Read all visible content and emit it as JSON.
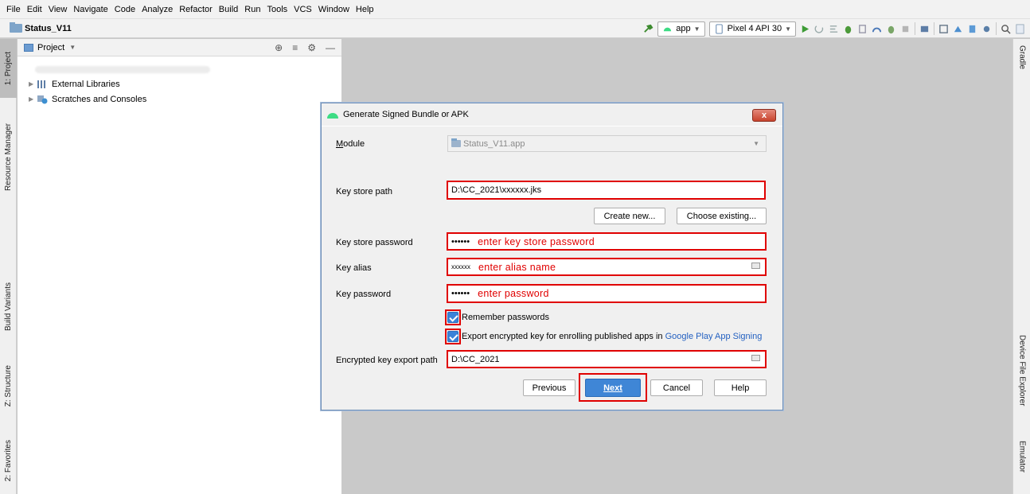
{
  "menu": [
    "File",
    "Edit",
    "View",
    "Navigate",
    "Code",
    "Analyze",
    "Refactor",
    "Build",
    "Run",
    "Tools",
    "VCS",
    "Window",
    "Help"
  ],
  "nav": {
    "project_name": "Status_V11",
    "run_config": "app",
    "device": "Pixel 4 API 30"
  },
  "left_tabs": [
    "1: Project",
    "Resource Manager",
    "Build Variants",
    "Z: Structure",
    "2: Favorites"
  ],
  "right_tabs": [
    "Gradle",
    "Device File Explorer",
    "Emulator"
  ],
  "project_panel": {
    "title": "Project",
    "tree": [
      "External Libraries",
      "Scratches and Consoles"
    ]
  },
  "dialog": {
    "title": "Generate Signed Bundle or APK",
    "close": "x",
    "module_label": "Module",
    "module_value": "Status_V11.app",
    "key_store_path_label": "Key store path",
    "key_store_path_value": "D:\\CC_2021\\xxxxxx.jks",
    "create_new": "Create new...",
    "choose_existing": "Choose existing...",
    "key_store_password_label": "Key store password",
    "key_store_password_mask": "••••••",
    "key_store_password_hint": "enter key store password",
    "key_alias_label": "Key alias",
    "key_alias_value": "xxxxxx",
    "key_alias_hint": "enter alias name",
    "key_password_label": "Key password",
    "key_password_mask": "••••••",
    "key_password_hint": "enter password",
    "remember_passwords": "Remember passwords",
    "export_key": "Export encrypted key for enrolling published apps in",
    "export_key_link": "Google Play App Signing",
    "export_path_label": "Encrypted key export path",
    "export_path_value": "D:\\CC_2021",
    "previous": "Previous",
    "next": "Next",
    "cancel": "Cancel",
    "help": "Help"
  }
}
